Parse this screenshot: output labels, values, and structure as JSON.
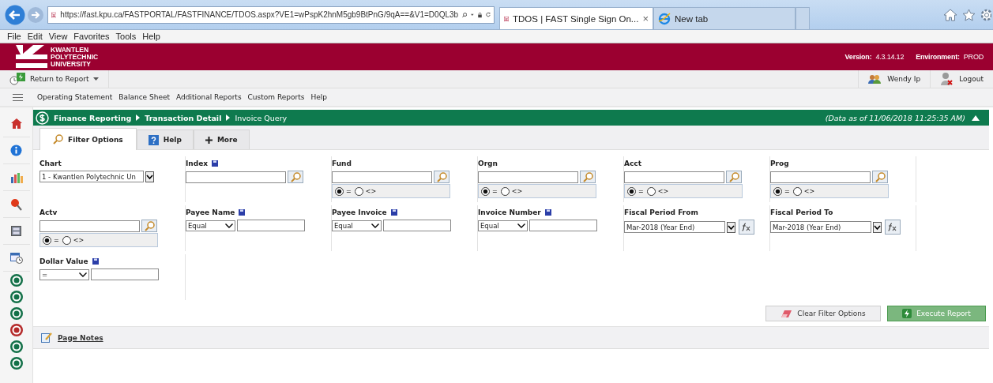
{
  "browser": {
    "url": "https://fast.kpu.ca/FASTPORTAL/FASTFINANCE/TDOS.aspx?VE1=wPspK2hnM5gb9BtPnG/9qA==&V1=D0QL3b",
    "tabs": [
      {
        "title": "TDOS | FAST Single Sign On...",
        "close": "×",
        "selected": true
      },
      {
        "title": "New tab",
        "selected": false
      }
    ],
    "menu": [
      "File",
      "Edit",
      "View",
      "Favorites",
      "Tools",
      "Help"
    ]
  },
  "banner": {
    "logo": [
      "KWANTLEN",
      "POLYTECHNIC",
      "UNIVERSITY"
    ],
    "version_label": "Version:",
    "version": "4.3.14.12",
    "environment_label": "Environment:",
    "environment": "PROD"
  },
  "toolbar": {
    "return": "Return to Report",
    "user": "Wendy Ip",
    "logout": "Logout"
  },
  "nav": [
    "Operating Statement",
    "Balance Sheet",
    "Additional Reports",
    "Custom Reports",
    "Help"
  ],
  "breadcrumb": [
    {
      "label": "Finance Reporting",
      "current": false
    },
    {
      "label": "Transaction Detail",
      "current": false
    },
    {
      "label": "Invoice Query",
      "current": true
    }
  ],
  "data_as_of": "(Data as of 11/06/2018 11:25:35 AM)",
  "tabs": [
    {
      "label": "Filter Options",
      "selected": true
    },
    {
      "label": "Help",
      "selected": false
    },
    {
      "label": "More",
      "selected": false
    }
  ],
  "filter_rows": [
    [
      {
        "label": "Chart",
        "saved": false,
        "kind": "select",
        "value": "1 - Kwantlen Polytechnic Un"
      },
      {
        "label": "Index",
        "saved": true,
        "kind": "lookup"
      },
      {
        "label": "Fund",
        "saved": false,
        "kind": "lookup",
        "match": [
          {
            "label": "=",
            "selected": true
          },
          {
            "label": "<>",
            "selected": false
          }
        ]
      },
      {
        "label": "Orgn",
        "saved": false,
        "kind": "lookup",
        "match": [
          {
            "label": "=",
            "selected": true
          },
          {
            "label": "<>",
            "selected": false
          }
        ]
      },
      {
        "label": "Acct",
        "saved": false,
        "kind": "lookup",
        "match": [
          {
            "label": "=",
            "selected": true
          },
          {
            "label": "<>",
            "selected": false
          }
        ]
      },
      {
        "label": "Prog",
        "saved": false,
        "kind": "lookup",
        "match": [
          {
            "label": "=",
            "selected": true
          },
          {
            "label": "<>",
            "selected": false
          }
        ]
      }
    ],
    [
      {
        "label": "Actv",
        "saved": false,
        "kind": "lookup",
        "match": [
          {
            "label": "=",
            "selected": true
          },
          {
            "label": "<>",
            "selected": false
          }
        ]
      },
      {
        "label": "Payee Name",
        "saved": true,
        "kind": "operator",
        "operator": "Equal"
      },
      {
        "label": "Payee Invoice",
        "saved": true,
        "kind": "operator",
        "operator": "Equal"
      },
      {
        "label": "Invoice Number",
        "saved": true,
        "kind": "operator",
        "operator": "Equal"
      },
      {
        "label": "Fiscal Period From",
        "saved": false,
        "kind": "period",
        "value": "Mar-2018 (Year End)"
      },
      {
        "label": "Fiscal Period To",
        "saved": false,
        "kind": "period",
        "value": "Mar-2018 (Year End)"
      }
    ],
    [
      {
        "label": "Dollar Value",
        "saved": true,
        "kind": "operator",
        "operator": "="
      }
    ]
  ],
  "buttons": [
    {
      "label": "Clear Filter Options",
      "kind": "clear"
    },
    {
      "label": "Execute Report",
      "kind": "execute"
    }
  ],
  "page_notes": "Page Notes"
}
